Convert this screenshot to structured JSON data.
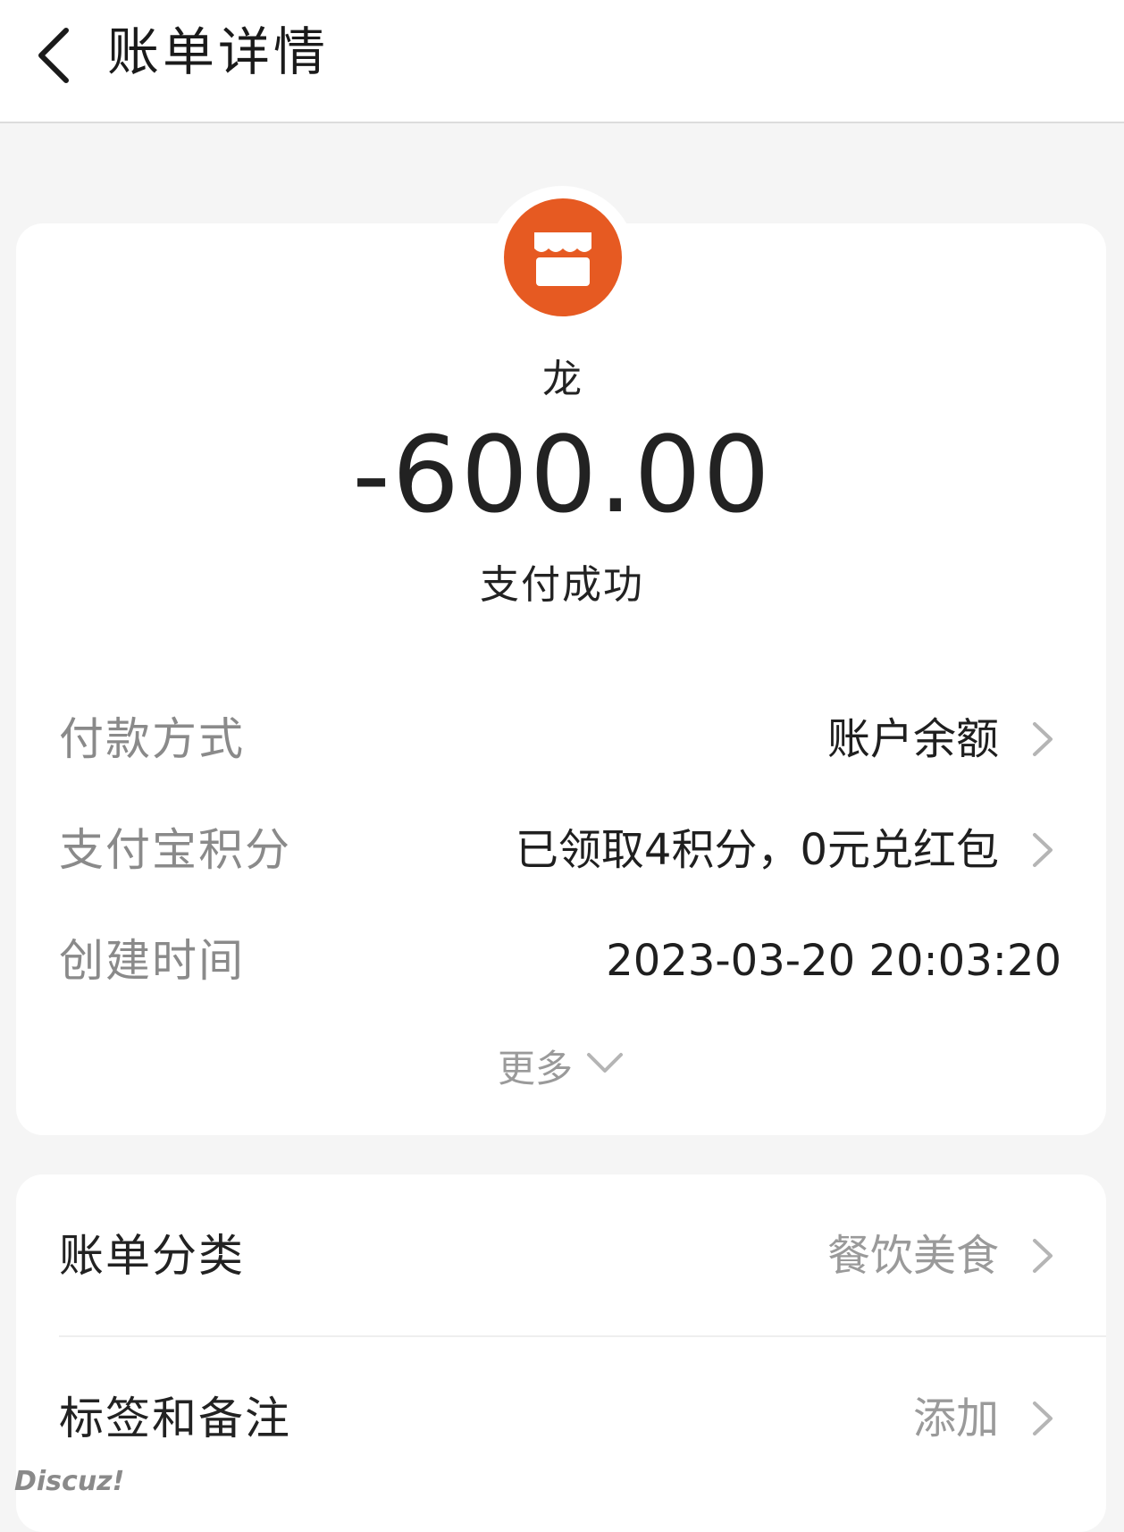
{
  "header": {
    "title": "账单详情"
  },
  "transaction": {
    "merchant_name": "龙",
    "amount": "-600.00",
    "status": "支付成功",
    "merchant_icon": "store-icon",
    "icon_color": "#e65a22"
  },
  "details": {
    "payment_method_label": "付款方式",
    "payment_method_value": "账户余额",
    "points_label": "支付宝积分",
    "points_value": "已领取4积分，0元兑红包",
    "created_time_label": "创建时间",
    "created_time_value": "2023-03-20 20:03:20",
    "more_label": "更多"
  },
  "extras": {
    "category_label": "账单分类",
    "category_value": "餐饮美食",
    "tags_label": "标签和备注",
    "tags_value": "添加"
  },
  "watermark": "Discuz!"
}
